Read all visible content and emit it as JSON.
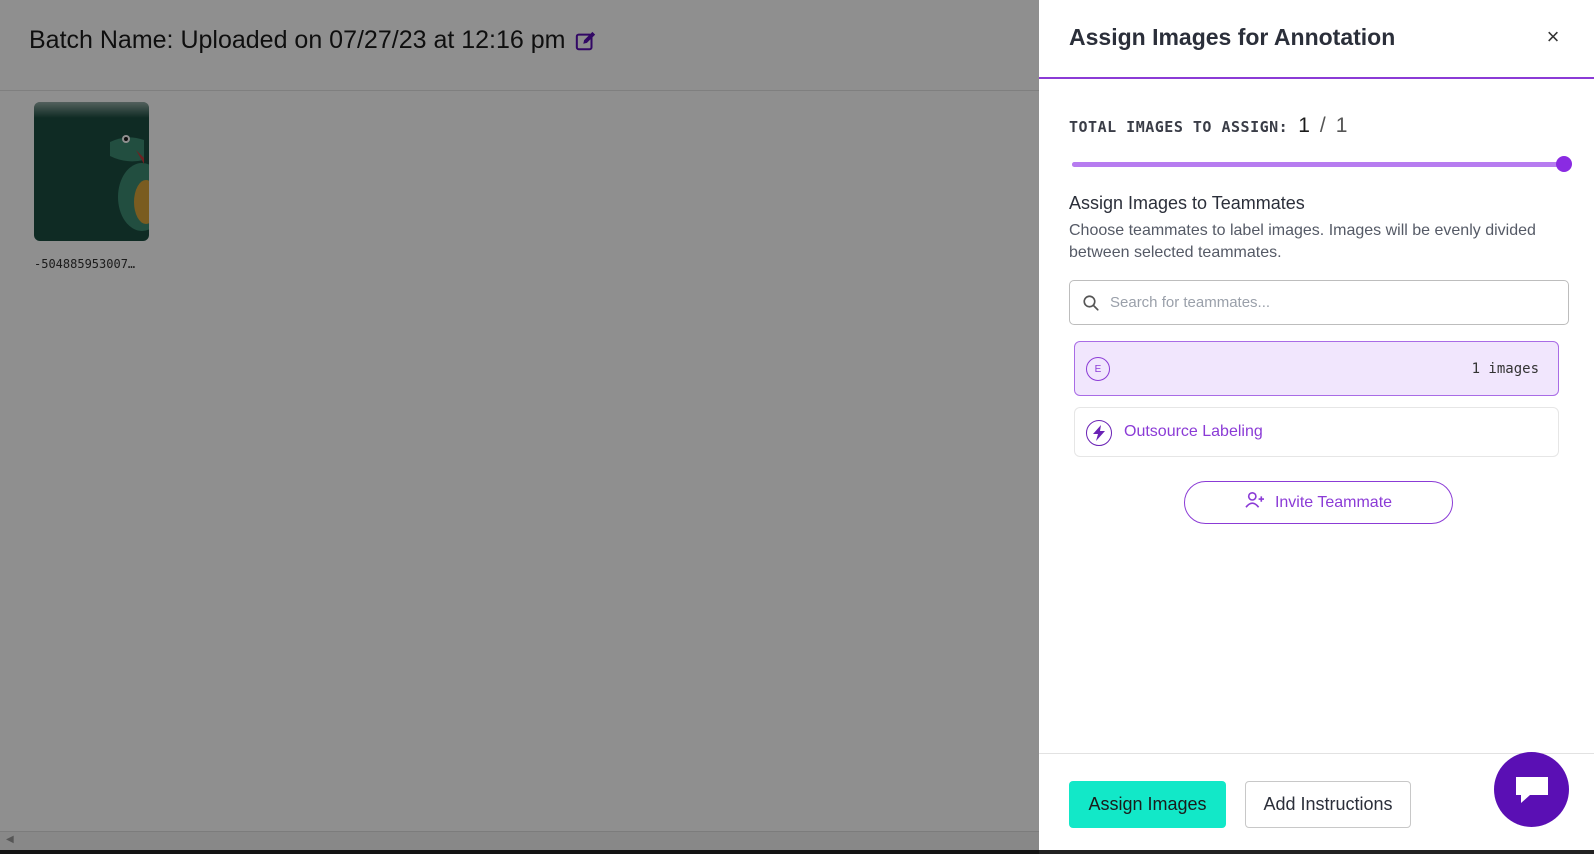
{
  "background": {
    "batch_title": "Batch Name: Uploaded on 07/27/23 at 12:16 pm",
    "edit_icon": "edit-icon",
    "thumbnail_name": "-504885953007…"
  },
  "panel": {
    "title": "Assign Images for Annotation",
    "close_icon": "close-icon",
    "total": {
      "label": "TOTAL IMAGES TO ASSIGN:",
      "count": "1",
      "separator": "/",
      "max": "1",
      "slider_fraction": 1.0
    },
    "assign_heading": "Assign Images to Teammates",
    "assign_description": "Choose teammates to label images. Images will be evenly divided between selected teammates.",
    "search_placeholder": "Search for teammates...",
    "teammates": [
      {
        "avatar": "E",
        "images": "1 images"
      }
    ],
    "outsource_label": "Outsource Labeling",
    "invite_label": "Invite Teammate",
    "assign_button": "Assign Images",
    "instructions_button": "Add Instructions"
  },
  "colors": {
    "accent": "#8b3bd6",
    "primary_button": "#12e8c8",
    "chat_button": "#5a0fb4"
  }
}
